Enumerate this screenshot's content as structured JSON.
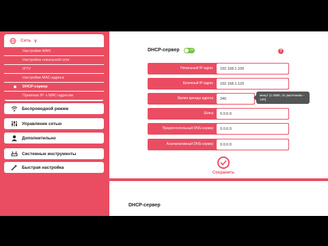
{
  "sidebar": {
    "network": {
      "label": "Сеть",
      "icon": "globe-icon",
      "items": [
        {
          "label": "Настройки WAN",
          "active": false
        },
        {
          "label": "Настройка локальной сети",
          "active": false
        },
        {
          "label": "IPTV",
          "active": false
        },
        {
          "label": "Настройки MAC-адреса",
          "active": false
        },
        {
          "label": "DHCP-сервер",
          "active": true
        },
        {
          "label": "Привязка IP- к MAC-адресам",
          "active": false
        }
      ]
    },
    "items": [
      {
        "label": "Беспроводной режим",
        "icon": "wifi-icon"
      },
      {
        "label": "Управление сетью",
        "icon": "sliders-icon"
      },
      {
        "label": "Дополнительно",
        "icon": "user-icon"
      },
      {
        "label": "Системные инструменты",
        "icon": "router-icon"
      },
      {
        "label": "Быстрая настройка",
        "icon": "wand-icon"
      }
    ]
  },
  "dhcp": {
    "title": "DHCP-сервер",
    "toggle_label": "ON",
    "toggle_on": true,
    "help": "?",
    "fields": [
      {
        "label": "Начальный IP-адрес",
        "value": "192.168.1.100"
      },
      {
        "label": "Конечный IP-адрес",
        "value": "192.168.1.120"
      },
      {
        "label": "Время аренды адреса",
        "value": "240"
      },
      {
        "label": "Шлюз",
        "value": "0.0.0.0"
      },
      {
        "label": "Предпочтительный DNS-сервер",
        "value": "0.0.0.0"
      },
      {
        "label": "Альтернативный DNS-сервер",
        "value": "0.0.0.0"
      }
    ],
    "lease_tooltip": "минут (1-2880, по умолчанию - 120)",
    "save_label": "Сохранить"
  },
  "section2": {
    "title": "DHCP-сервер"
  },
  "colors": {
    "accent": "#ea4d62",
    "toggle": "#7ac143"
  }
}
